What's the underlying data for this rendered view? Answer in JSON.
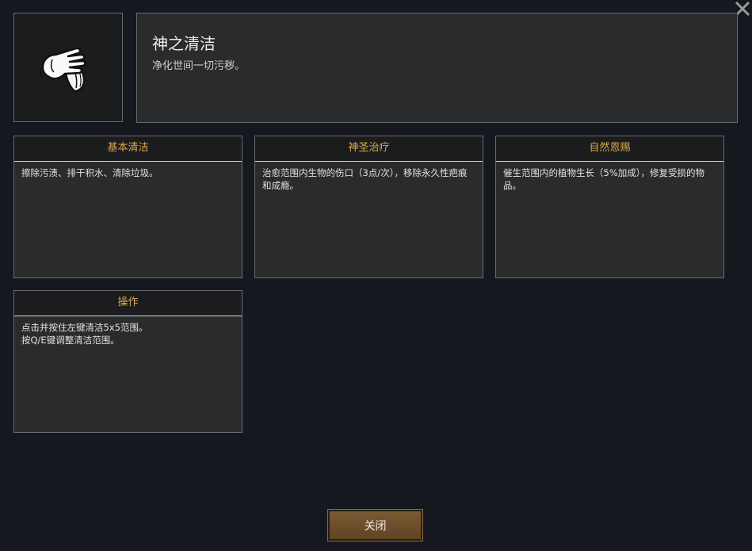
{
  "skill": {
    "icon": "white-glove-holding-cloth-icon",
    "title": "神之清洁",
    "description": "净化世间一切污秽。"
  },
  "cards": [
    {
      "title": "基本清洁",
      "body": "擦除污渍、排干积水、清除垃圾。"
    },
    {
      "title": "神圣治疗",
      "body": "治愈范围内生物的伤口（3点/次），移除永久性疤痕和成瘾。"
    },
    {
      "title": "自然恩赐",
      "body": "催生范围内的植物生长（5%加成），修复受损的物品。"
    },
    {
      "title": "操作",
      "body": "点击并按住左键清洁5x5范围。\n按Q/E键调整清洁范围。"
    }
  ],
  "footer": {
    "close_label": "关闭"
  },
  "window": {
    "close_icon": "close-icon"
  },
  "colors": {
    "background": "#15191f",
    "panel": "#2a2b2d",
    "card_header": "#1b1c1e",
    "accent_gold": "#dba94b",
    "button_brown": "#6b4d2b"
  }
}
